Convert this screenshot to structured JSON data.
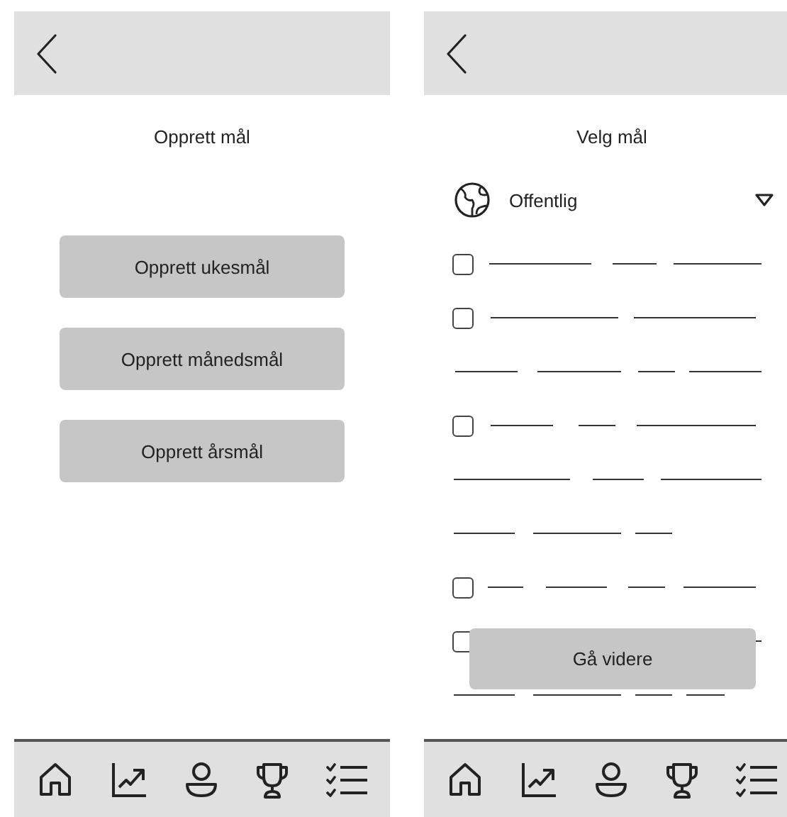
{
  "create_screen": {
    "title": "Opprett mål",
    "buttons": [
      "Opprett ukesmål",
      "Opprett månedsmål",
      "Opprett årsmål"
    ]
  },
  "choose_screen": {
    "title": "Velg mål",
    "dropdown": {
      "value": "Offentlig"
    },
    "goals": [
      {
        "checked": false
      },
      {
        "checked": false
      },
      {
        "checked": false
      },
      {
        "checked": false
      },
      {
        "checked": false
      }
    ],
    "continue_button": "Gå videre"
  }
}
